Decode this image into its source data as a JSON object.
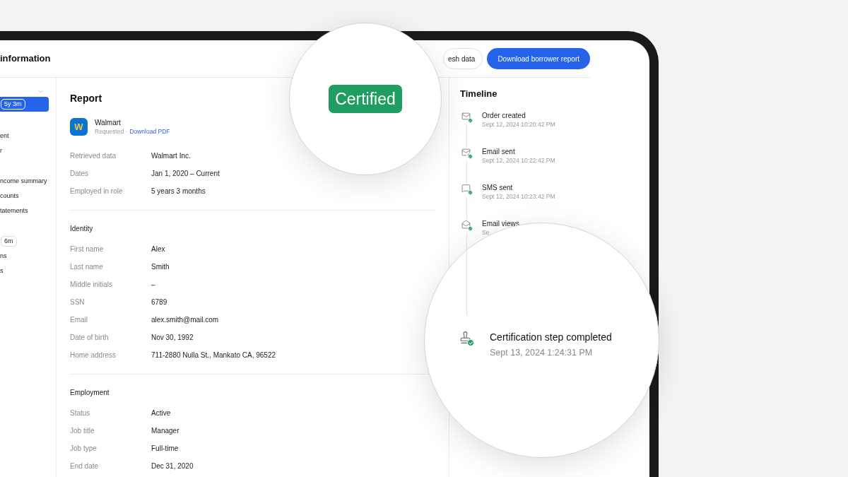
{
  "header": {
    "title": "information",
    "buttons": [
      {
        "label": "esh data",
        "kind": "secondary"
      },
      {
        "label": "Download borrower report",
        "kind": "primary"
      }
    ]
  },
  "sidebar": {
    "groups": [
      [
        {
          "badge": "5y 3m",
          "selected": true
        }
      ],
      [
        {
          "label": "ent",
          "selected": false
        },
        {
          "label": "r",
          "selected": false
        }
      ],
      [
        {
          "label": "ncome summary",
          "selected": false
        },
        {
          "label": "counts",
          "selected": false
        },
        {
          "label": "tatements",
          "selected": false
        }
      ],
      [
        {
          "badge": "6m",
          "selected": false
        },
        {
          "label": "ns",
          "selected": false
        },
        {
          "label": "s",
          "selected": false
        }
      ]
    ]
  },
  "report": {
    "title": "Report",
    "employer": {
      "logo": "W",
      "name": "Walmart",
      "status": "Requested ·",
      "link": "Download PDF"
    },
    "rows": [
      {
        "label": "Retrieved data",
        "value": "Walmart Inc."
      },
      {
        "label": "Dates",
        "value": "Jan 1, 2020 – Current"
      },
      {
        "label": "Employed in role",
        "value": "5 years 3 months"
      }
    ]
  },
  "sections": [
    {
      "title": "Identity",
      "rows": [
        {
          "label": "First name",
          "value": "Alex"
        },
        {
          "label": "Last name",
          "value": "Smith"
        },
        {
          "label": "Middle initials",
          "value": "–"
        },
        {
          "label": "SSN",
          "value": "6789"
        },
        {
          "label": "Email",
          "value": "alex.smith@mail.com"
        },
        {
          "label": "Date of birth",
          "value": "Nov 30, 1992"
        },
        {
          "label": "Home address",
          "value": "711-2880 Nulla St., Mankato CA, 96522"
        }
      ]
    },
    {
      "title": "Employment",
      "rows": [
        {
          "label": "Status",
          "value": "Active"
        },
        {
          "label": "Job title",
          "value": "Manager"
        },
        {
          "label": "Job type",
          "value": "Full-time"
        },
        {
          "label": "End date",
          "value": "Dec 31, 2020"
        }
      ]
    }
  ],
  "timeline": {
    "title": "Timeline",
    "events": [
      {
        "kind": "created",
        "title": "Order created",
        "time": "Sept 12, 2024 10:20:42 PM"
      },
      {
        "kind": "email",
        "title": "Email sent",
        "time": "Sept 12, 2024 10:22:42 PM"
      },
      {
        "kind": "sms",
        "title": "SMS sent",
        "time": "Sept 12, 2024 10:23:42 PM"
      },
      {
        "kind": "viewed",
        "title": "Email views",
        "time": "Se"
      }
    ]
  },
  "magnifier_badge": {
    "label": "Certified"
  },
  "magnifier_event": {
    "kind": "certification",
    "title": "Certification step completed",
    "time": "Sept 13, 2024 1:24:31 PM"
  }
}
